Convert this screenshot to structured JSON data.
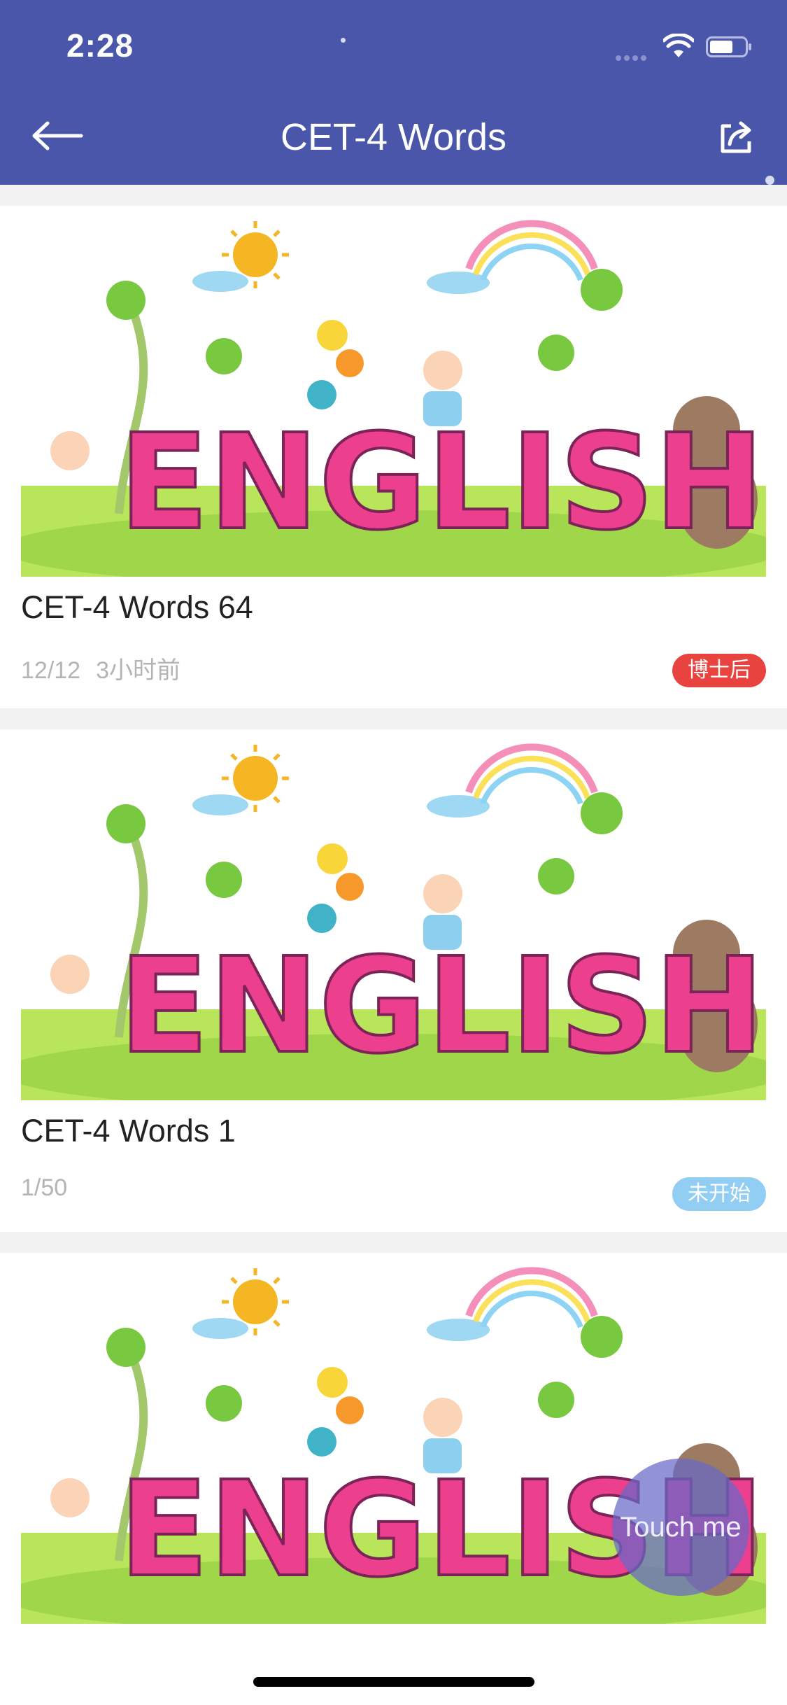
{
  "status_bar": {
    "time": "2:28"
  },
  "header": {
    "title": "CET-4 Words",
    "back_icon": "arrow-left-icon",
    "share_icon": "share-icon"
  },
  "cards": [
    {
      "art_text": "ENGLISH",
      "title": "CET-4 Words 64",
      "progress": "12/12",
      "time_ago": "3小时前",
      "badge": "博士后",
      "badge_color": "#e8433e"
    },
    {
      "art_text": "ENGLISH",
      "title": "CET-4 Words 1",
      "progress": "1/50",
      "time_ago": "",
      "badge": "未开始",
      "badge_color": "#92cdf4"
    },
    {
      "art_text": "ENGLISH"
    }
  ],
  "floating_button": {
    "label": "Touch me"
  },
  "colors": {
    "header_bg": "#4a56aa",
    "page_bg": "#f2f2f2",
    "title_text": "#222222",
    "meta_text": "#b4b4b4"
  }
}
